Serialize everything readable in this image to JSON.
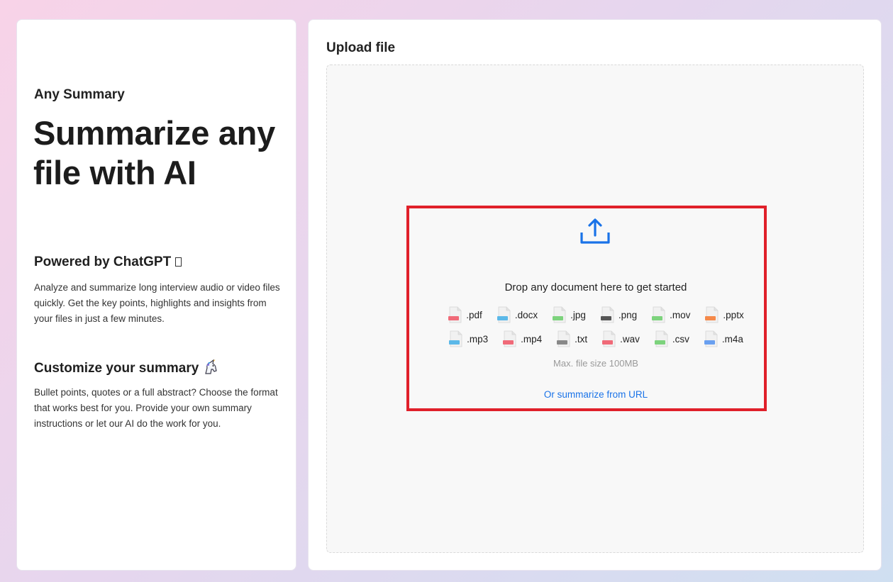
{
  "left": {
    "brand": "Any Summary",
    "headline": "Summarize any file with AI",
    "features": [
      {
        "title": "Powered by ChatGPT",
        "description": "Analyze and summarize long interview audio or video files quickly. Get the key points, highlights and insights from your files in just a few minutes."
      },
      {
        "title": "Customize your summary",
        "description": "Bullet points, quotes or a full abstract? Choose the format that works best for you. Provide your own summary instructions or let our AI do the work for you."
      }
    ]
  },
  "upload": {
    "title": "Upload file",
    "drop_text": "Drop any document here to get started",
    "file_types_row1": [
      {
        "ext": ".pdf",
        "label": "PDF",
        "color": "#f06a78"
      },
      {
        "ext": ".docx",
        "label": "DOCX",
        "color": "#5bb8e8"
      },
      {
        "ext": ".jpg",
        "label": "JPG",
        "color": "#7dd37d"
      },
      {
        "ext": ".png",
        "label": "PNG",
        "color": "#555555"
      },
      {
        "ext": ".mov",
        "label": "MOV",
        "color": "#7dd37d"
      },
      {
        "ext": ".pptx",
        "label": "PPTX",
        "color": "#f5894a"
      }
    ],
    "file_types_row2": [
      {
        "ext": ".mp3",
        "label": "MP3",
        "color": "#5bb8e8"
      },
      {
        "ext": ".mp4",
        "label": "MP4",
        "color": "#f06a78"
      },
      {
        "ext": ".txt",
        "label": "TXT",
        "color": "#888888"
      },
      {
        "ext": ".wav",
        "label": "WAV",
        "color": "#f06a78"
      },
      {
        "ext": ".csv",
        "label": "CSV",
        "color": "#7dd37d"
      },
      {
        "ext": ".m4a",
        "label": "M4A",
        "color": "#6aa0f0"
      }
    ],
    "max_size": "Max. file size 100MB",
    "url_link": "Or summarize from URL",
    "accent_color": "#1a73e8",
    "highlight_color": "#e0202a"
  }
}
